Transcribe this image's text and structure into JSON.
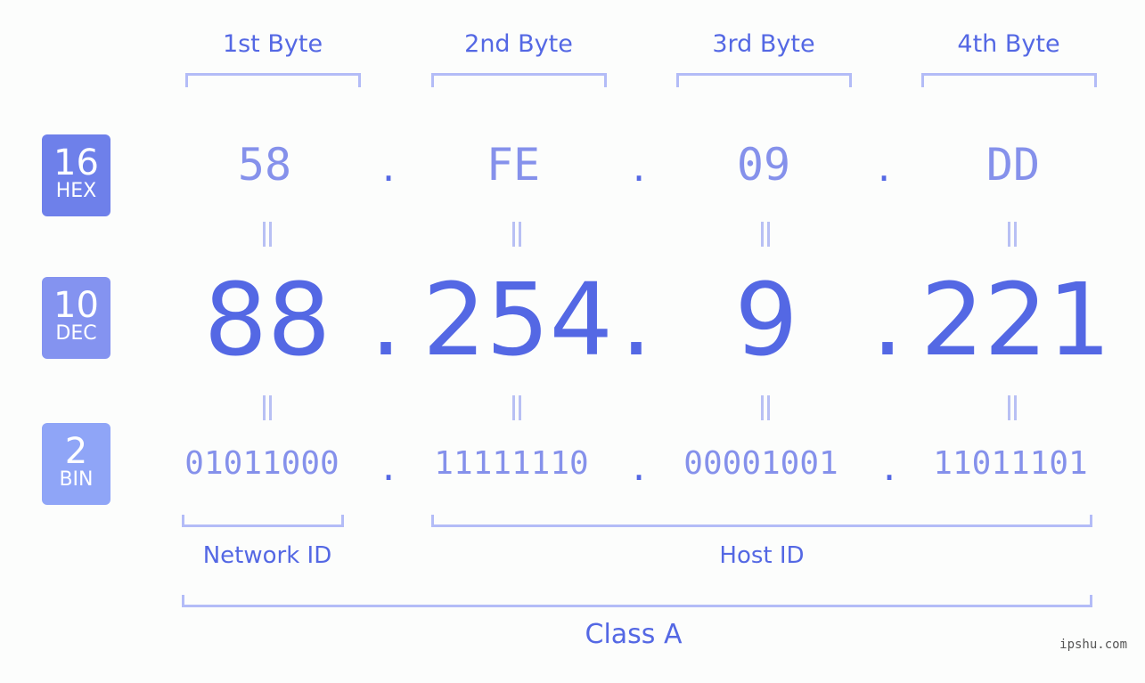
{
  "bytes": [
    {
      "label": "1st Byte",
      "hex": "58",
      "dec": "88",
      "bin": "01011000"
    },
    {
      "label": "2nd Byte",
      "hex": "FE",
      "dec": "254",
      "bin": "11111110"
    },
    {
      "label": "3rd Byte",
      "hex": "09",
      "dec": "9",
      "bin": "00001001"
    },
    {
      "label": "4th Byte",
      "hex": "DD",
      "dec": "221",
      "bin": "11011101"
    }
  ],
  "separator": ".",
  "badges": {
    "hex": {
      "num": "16",
      "name": "HEX",
      "color": "#6e80ea"
    },
    "dec": {
      "num": "10",
      "name": "DEC",
      "color": "#8493f0"
    },
    "bin": {
      "num": "2",
      "name": "BIN",
      "color": "#8fa5f7"
    }
  },
  "groups": {
    "network": "Network ID",
    "host": "Host ID",
    "class": "Class A"
  },
  "watermark": "ipshu.com"
}
